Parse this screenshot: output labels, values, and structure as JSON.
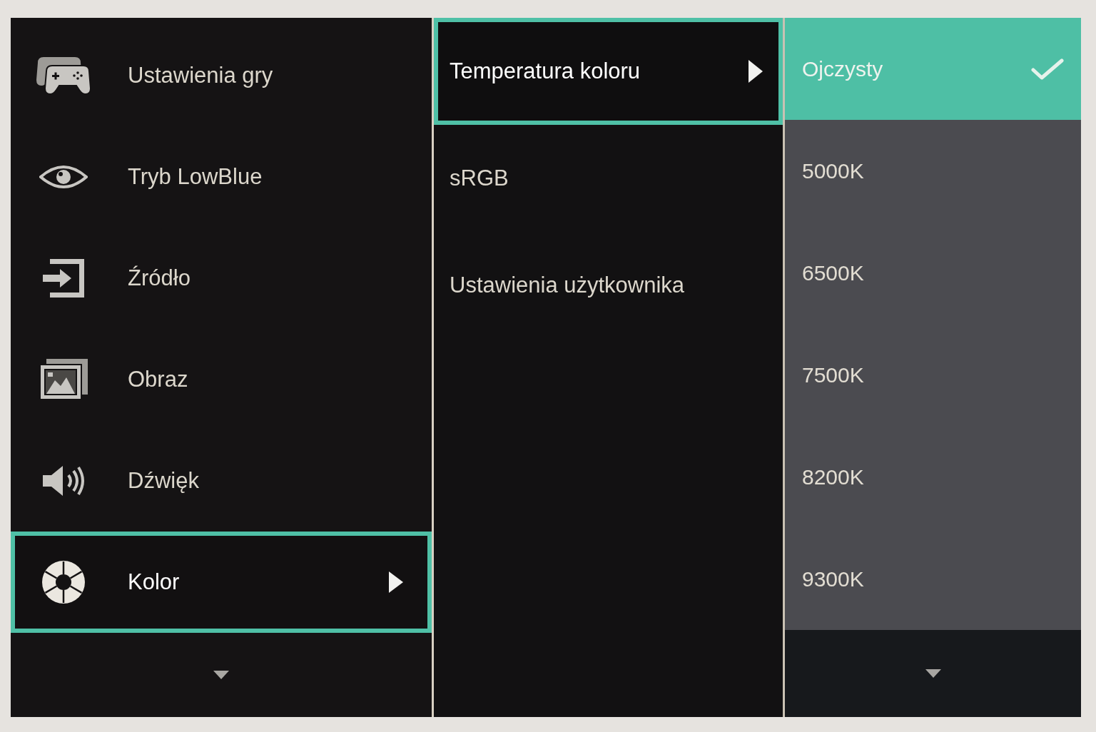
{
  "main_menu": {
    "items": [
      {
        "label": "Ustawienia gry",
        "selected": false
      },
      {
        "label": "Tryb LowBlue",
        "selected": false
      },
      {
        "label": "Źródło",
        "selected": false
      },
      {
        "label": "Obraz",
        "selected": false
      },
      {
        "label": "Dźwięk",
        "selected": false
      },
      {
        "label": "Kolor",
        "selected": true
      }
    ],
    "more_below": true
  },
  "color_menu": {
    "items": [
      {
        "label": "Temperatura koloru",
        "selected": true
      },
      {
        "label": "sRGB",
        "selected": false
      },
      {
        "label": "Ustawienia użytkownika",
        "selected": false
      }
    ]
  },
  "color_temperature": {
    "items": [
      {
        "label": "Ojczysty",
        "selected": true,
        "checked": true
      },
      {
        "label": "5000K",
        "selected": false,
        "checked": false
      },
      {
        "label": "6500K",
        "selected": false,
        "checked": false
      },
      {
        "label": "7500K",
        "selected": false,
        "checked": false
      },
      {
        "label": "8200K",
        "selected": false,
        "checked": false
      },
      {
        "label": "9300K",
        "selected": false,
        "checked": false
      }
    ],
    "more_below": true
  }
}
